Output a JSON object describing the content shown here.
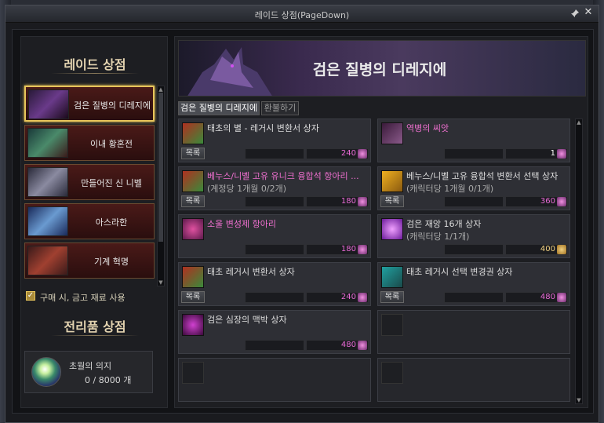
{
  "window": {
    "title": "레이드 상점(PageDown)",
    "pin": "pin-icon",
    "close": "close-icon"
  },
  "left": {
    "raid_shop_title": "레이드 상점",
    "shops": [
      {
        "label": "검은 질병의 디레지에",
        "selected": true
      },
      {
        "label": "이내 황혼전",
        "selected": false
      },
      {
        "label": "만들어진 신 니벨",
        "selected": false
      },
      {
        "label": "아스라한",
        "selected": false
      },
      {
        "label": "기계 혁명",
        "selected": false
      }
    ],
    "checkbox_label": "구매 시, 금고 재료 사용",
    "checkbox_checked": true,
    "trophy_title": "전리품 상점",
    "trophy_name": "초월의 의지",
    "trophy_count": "0 / 8000 개"
  },
  "right": {
    "banner_title": "검은 질병의 디레지에",
    "tabs": [
      "검은 질병의 디레지에",
      "환불하기"
    ],
    "list_button": "목록",
    "items": [
      {
        "name": "태초의 별 - 레거시 변환서 상자",
        "sub": "",
        "price": "240",
        "name_color": "white",
        "price_color": "pink",
        "has_list": true,
        "currency": "pink"
      },
      {
        "name": "역병의 씨앗",
        "sub": "",
        "price": "1",
        "name_color": "pink",
        "price_color": "white",
        "has_list": false,
        "currency": "pink"
      },
      {
        "name": "베누스/니벨 고유 유니크 융합석 항아리 ...",
        "sub": "(계정당 1개월 0/2개)",
        "price": "180",
        "name_color": "pink",
        "price_color": "pink",
        "has_list": true,
        "currency": "pink"
      },
      {
        "name": "베누스/니벨 고유 융합석 변환서 선택 상자",
        "sub": "(캐릭터당 1개월 0/1개)",
        "price": "360",
        "name_color": "white",
        "price_color": "pink",
        "has_list": true,
        "currency": "pink",
        "icon_badge": "고유"
      },
      {
        "name": "소울 변성제 항아리",
        "sub": "",
        "price": "180",
        "name_color": "pink",
        "price_color": "pink",
        "has_list": false,
        "currency": "pink"
      },
      {
        "name": "검은 재앙 16개 상자",
        "sub": "(캐릭터당 1/1개)",
        "price": "400",
        "name_color": "white",
        "price_color": "gold",
        "has_list": false,
        "currency": "gold"
      },
      {
        "name": "태초 레거시 변환서 상자",
        "sub": "",
        "price": "240",
        "name_color": "white",
        "price_color": "pink",
        "has_list": true,
        "currency": "pink"
      },
      {
        "name": "태초 레거시 선택 변경권 상자",
        "sub": "",
        "price": "480",
        "name_color": "white",
        "price_color": "pink",
        "has_list": true,
        "currency": "pink"
      },
      {
        "name": "검은 심장의 맥박 상자",
        "sub": "",
        "price": "480",
        "name_color": "white",
        "price_color": "pink",
        "has_list": false,
        "currency": "pink"
      }
    ],
    "empty_slots": 3
  }
}
